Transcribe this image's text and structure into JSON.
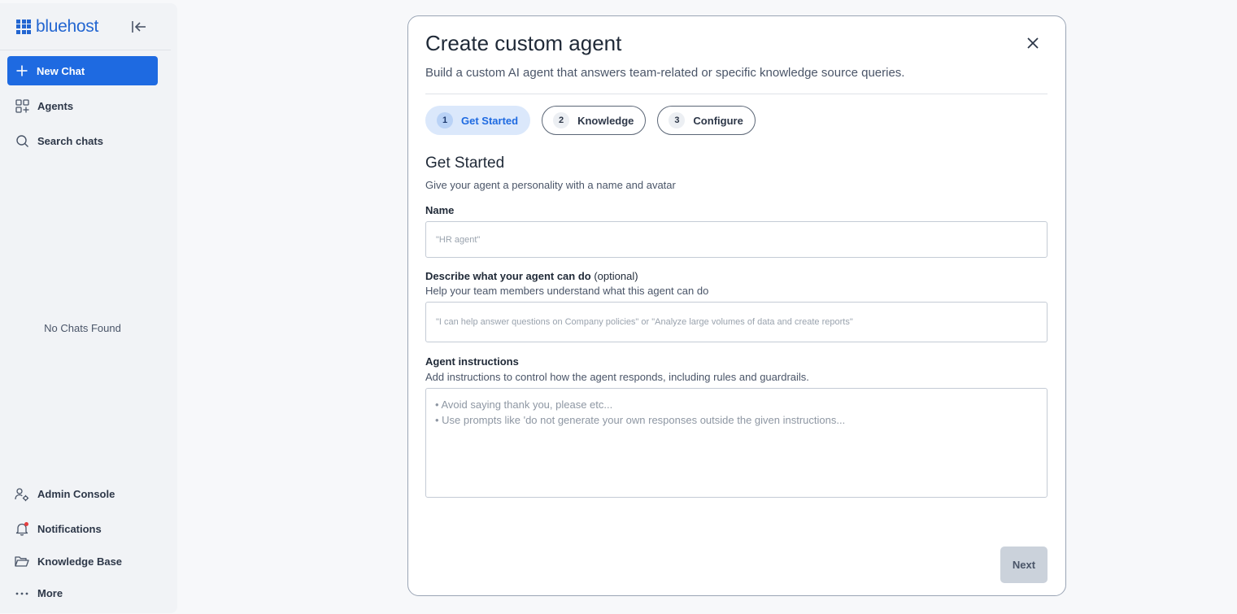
{
  "brand": {
    "name": "bluehost"
  },
  "sidebar": {
    "new_chat": "New Chat",
    "items": [
      {
        "label": "Agents",
        "icon": "agents-icon"
      },
      {
        "label": "Search chats",
        "icon": "search-icon"
      }
    ],
    "empty_state": "No Chats Found",
    "bottom_items": [
      {
        "label": "Admin Console",
        "icon": "admin-console-icon"
      },
      {
        "label": "Notifications",
        "icon": "bell-icon"
      },
      {
        "label": "Knowledge Base",
        "icon": "folder-icon"
      },
      {
        "label": "More",
        "icon": "more-icon"
      }
    ]
  },
  "modal": {
    "title": "Create custom agent",
    "subtitle": "Build a custom AI agent that answers team-related or specific knowledge source queries.",
    "steps": [
      {
        "num": "1",
        "label": "Get Started",
        "active": true
      },
      {
        "num": "2",
        "label": "Knowledge",
        "active": false
      },
      {
        "num": "3",
        "label": "Configure",
        "active": false
      }
    ],
    "section_title": "Get Started",
    "section_subtitle": "Give your agent a personality with a name and avatar",
    "name": {
      "label": "Name",
      "value": "",
      "placeholder": "\"HR agent\""
    },
    "description": {
      "label": "Describe what your agent can do",
      "optional": "(optional)",
      "help": "Help your team members understand what this agent can do",
      "value": "",
      "placeholder": "\"I can help answer questions on Company policies\" or \"Analyze large volumes of data and create reports\""
    },
    "instructions": {
      "label": "Agent instructions",
      "help": "Add instructions to control how the agent responds, including rules and guardrails.",
      "value": "",
      "placeholder": "• Avoid saying thank you, please etc...\n• Use prompts like 'do not generate your own responses outside the given instructions..."
    },
    "next_label": "Next"
  },
  "colors": {
    "accent": "#1e6ae1",
    "brand": "#2366d1",
    "step_active_bg": "#dbe8fb",
    "notification_dot": "#e53e3e",
    "disabled_button": "#cbd2db"
  }
}
